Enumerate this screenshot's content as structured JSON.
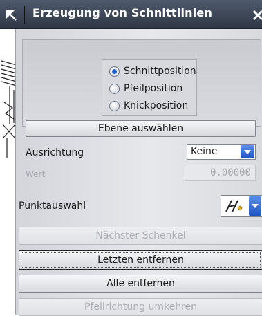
{
  "window": {
    "title": "Erzeugung von Schnittlinien"
  },
  "position_group": {
    "options": [
      {
        "label": "Schnittposition",
        "checked": true
      },
      {
        "label": "Pfeilposition",
        "checked": false
      },
      {
        "label": "Knickposition",
        "checked": false
      }
    ]
  },
  "buttons": {
    "select_plane": "Ebene auswählen",
    "next_leg": "Nächster Schenkel",
    "remove_last": "Letzten entfernen",
    "remove_all": "Alle entfernen",
    "reverse_arrow": "Pfeilrichtung umkehren"
  },
  "orientation": {
    "label": "Ausrichtung",
    "value": "Keine"
  },
  "value_field": {
    "label": "Wert",
    "value": "0.00000"
  },
  "point_selection": {
    "label": "Punktauswahl",
    "icon": "snap-point-icon"
  },
  "colors": {
    "title_bar": "#3a4353",
    "radio_selected": "#1d62d8",
    "dropdown_accent": "#2a62d0",
    "disabled_text": "#a9adb4"
  }
}
